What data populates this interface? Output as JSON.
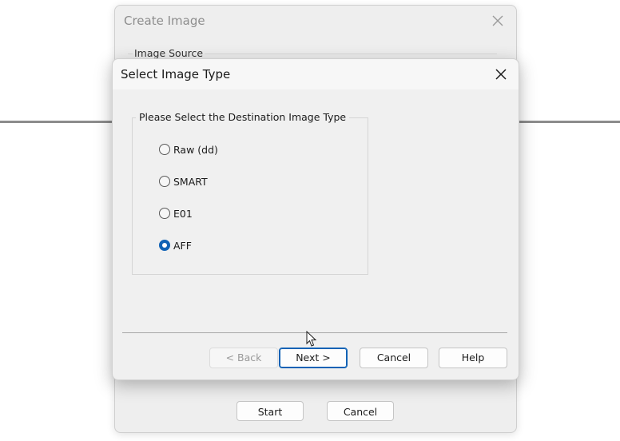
{
  "background_dialog": {
    "title": "Create Image",
    "group_label": "Image Source",
    "buttons": {
      "start": "Start",
      "cancel": "Cancel"
    }
  },
  "dialog": {
    "title": "Select Image Type",
    "group_label": "Please Select the Destination Image Type",
    "options": [
      {
        "label": "Raw (dd)",
        "checked": false
      },
      {
        "label": "SMART",
        "checked": false
      },
      {
        "label": "E01",
        "checked": false
      },
      {
        "label": "AFF",
        "checked": true
      }
    ],
    "buttons": {
      "back": "< Back",
      "next": "Next >",
      "cancel": "Cancel",
      "help": "Help"
    }
  },
  "colors": {
    "accent": "#0f62b5",
    "dialog_bg": "#f0f0f0"
  },
  "icons": {
    "close": "close-icon",
    "cursor": "mouse-pointer-icon"
  }
}
